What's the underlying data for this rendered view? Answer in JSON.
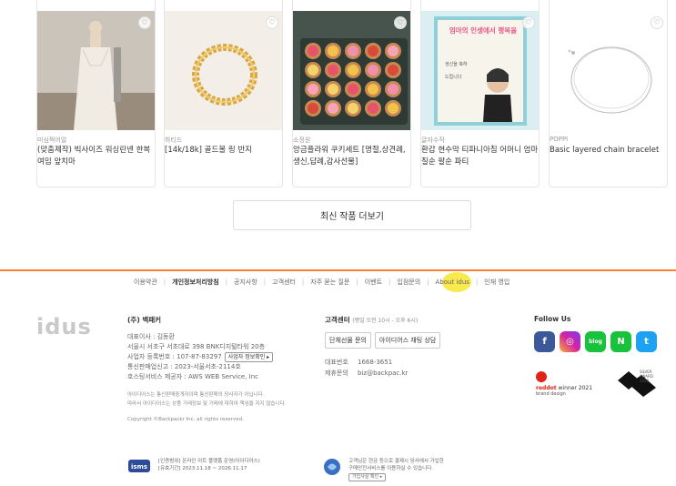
{
  "products": [
    {
      "shop": "미심쩍어얼",
      "title": "(맞춤제작) 빅사이즈 워싱린넨 한복 여밈 앞치마"
    },
    {
      "shop": "하티드",
      "title": "[14k/18k] 골드볼 링 반지"
    },
    {
      "shop": "소정원",
      "title": "앙금플라워 쿠키세트 [명절,상견례,생신,답례,감사선물]"
    },
    {
      "shop": "글자수작",
      "title": "환갑 현수막 티파니아침 어머니 엄마 칠순 팔순 파티"
    },
    {
      "shop": "POPPI",
      "title": "Basic layered chain bracelet"
    }
  ],
  "product_images": [
    {
      "name": "apron-image",
      "colors": [
        "#c9c2b8",
        "#e8e2d8"
      ]
    },
    {
      "name": "ring-image",
      "colors": [
        "#f2eee7",
        "#f8f5ef"
      ]
    },
    {
      "name": "cookie-set-image",
      "colors": [
        "#3c4a44",
        "#5b6b60"
      ]
    },
    {
      "name": "banner-image",
      "colors": [
        "#d8ecf0",
        "#e8f6f8"
      ]
    },
    {
      "name": "bracelet-image",
      "colors": [
        "#ffffff",
        "#fafafa"
      ]
    }
  ],
  "banner_text": "엄마의 인생에서 행복을",
  "heart_icon": "♡",
  "more_button": "최신 작품 더보기",
  "footer_links": [
    {
      "label": "이용약관",
      "bold": false
    },
    {
      "label": "개인정보처리방침",
      "bold": true
    },
    {
      "label": "공지사항",
      "bold": false
    },
    {
      "label": "고객센터",
      "bold": false
    },
    {
      "label": "자주 묻는 질문",
      "bold": false
    },
    {
      "label": "이벤트",
      "bold": false
    },
    {
      "label": "입점문의",
      "bold": false
    },
    {
      "label": "About idus",
      "bold": false
    },
    {
      "label": "인재 영입",
      "bold": false
    }
  ],
  "logo": "idus",
  "company": {
    "name": "(주) 백패커",
    "ceo": "대표이사 : 김동환",
    "address": "서울시 서초구 서초대로 398 BNK디지털타워 20층",
    "biz_no": "사업자 등록번호 : 107-87-83297",
    "biz_check": "사업자 정보확인 ▸",
    "mail_order": "통신판매업신고 : 2023-서울서초-2114호",
    "hosting": "호스팅서비스 제공자 : AWS WEB Service, Inc",
    "notice1": "아이디어스는 통신판매중개자이며 통신판매의 당사자가 아닙니다.",
    "notice2": "따라서 아이디어스는 상품 거래정보 및 거래에 대하여 책임을 지지 않습니다.",
    "copyright": "Copyright ©Backpackr Inc. all rights reserved."
  },
  "cs": {
    "title": "고객센터",
    "hours": "(평일 오전 10시 - 오후 6시)",
    "btn1": "단체선물 문의",
    "btn2": "아이디어스 채팅 상담",
    "phone_label": "대표번호",
    "phone": "1668-3651",
    "partner_label": "제휴문의",
    "email": "biz@backpac.kr"
  },
  "follow": {
    "title": "Follow Us",
    "icons": [
      {
        "name": "facebook-icon",
        "glyph": "f",
        "color": "#3b5998"
      },
      {
        "name": "instagram-icon",
        "glyph": "◎",
        "color": "#d6249f"
      },
      {
        "name": "blog-icon",
        "glyph": "blog",
        "color": "#19c23b"
      },
      {
        "name": "naver-post-icon",
        "glyph": "N",
        "color": "#19c23b"
      },
      {
        "name": "twitter-icon",
        "glyph": "t",
        "color": "#1da1f2"
      }
    ]
  },
  "awards": {
    "reddot_brand": "reddot",
    "reddot_rest": " winner 2021",
    "reddot_sub": "brand design",
    "silver": "SILVER AWARD 2022"
  },
  "certs": {
    "isms_logo": "isms",
    "isms_line1": "[인증범위] 온라인 아트 플랫폼 운영(아이디어스)",
    "isms_line2": "[유효기간] 2023.11.18 ~ 2026.11.17",
    "escrow_line1": "고객님은 현금 등으로 결제시 당사에서 가입한",
    "escrow_line2": "구매안전서비스를 이용하실 수 있습니다.",
    "escrow_btn": "가입사실 확인 ▸"
  }
}
